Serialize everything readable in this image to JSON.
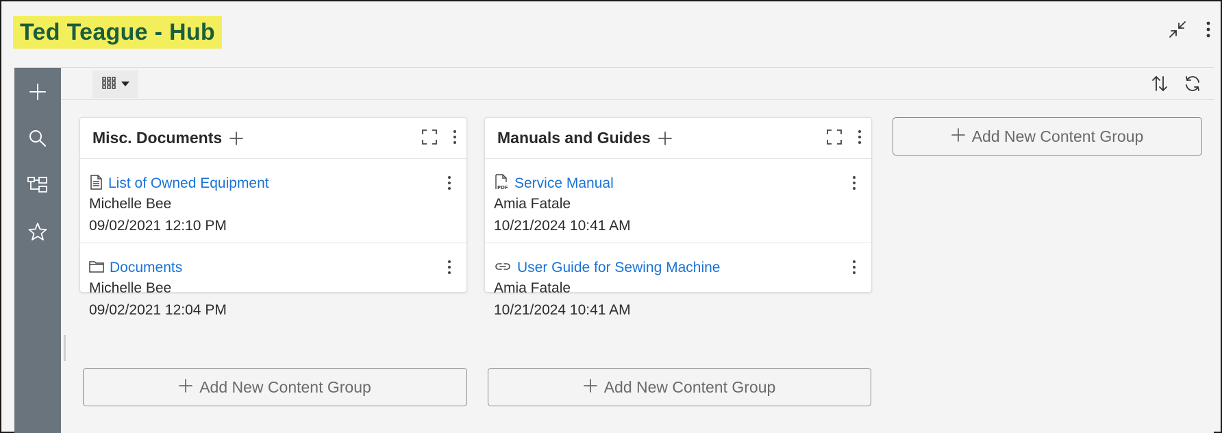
{
  "header": {
    "title": "Ted Teague - Hub",
    "icons": [
      "collapse-icon",
      "more-vertical-icon"
    ],
    "title_highlight_color": "#f3ef5c",
    "title_color": "#1b5d3f"
  },
  "sidebar": {
    "background": "#6a747c",
    "items": [
      {
        "icon": "plus-icon"
      },
      {
        "icon": "search-icon"
      },
      {
        "icon": "tree-icon"
      },
      {
        "icon": "star-icon"
      }
    ]
  },
  "toolbar": {
    "icons": [
      "grid-view-icon",
      "sort-icon",
      "refresh-icon"
    ]
  },
  "groups": [
    {
      "title": "Misc. Documents",
      "items": [
        {
          "icon": "document-icon",
          "name": "List of Owned Equipment",
          "owner": "Michelle Bee",
          "date": "09/02/2021 12:10 PM"
        },
        {
          "icon": "folder-icon",
          "name": "Documents",
          "owner": "Michelle Bee",
          "date": "09/02/2021 12:04 PM"
        }
      ]
    },
    {
      "title": "Manuals and Guides",
      "items": [
        {
          "icon": "pdf-icon",
          "name": "Service Manual",
          "owner": "Amia Fatale",
          "date": "10/21/2024 10:41 AM"
        },
        {
          "icon": "link-icon",
          "name": "User Guide for Sewing Machine",
          "owner": "Amia Fatale",
          "date": "10/21/2024 10:41 AM"
        }
      ]
    }
  ],
  "add_group_label": "Add New Content Group",
  "link_color": "#1a73d6"
}
